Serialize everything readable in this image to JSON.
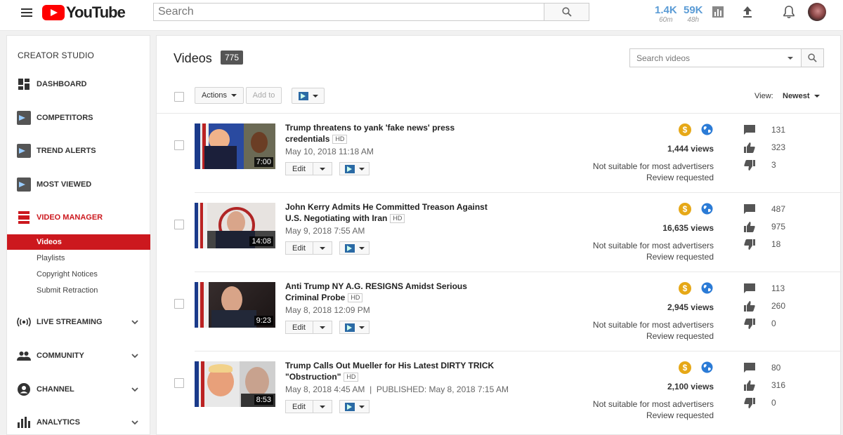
{
  "topbar": {
    "logo_text": "YouTube",
    "search_placeholder": "Search",
    "stats": [
      {
        "value": "1.4K",
        "period": "60m"
      },
      {
        "value": "59K",
        "period": "48h"
      }
    ]
  },
  "sidebar": {
    "title": "CREATOR STUDIO",
    "items": [
      {
        "label": "DASHBOARD",
        "icon": "dashboard-icon"
      },
      {
        "label": "COMPETITORS",
        "icon": "vidiq-icon"
      },
      {
        "label": "TREND ALERTS",
        "icon": "vidiq-icon"
      },
      {
        "label": "MOST VIEWED",
        "icon": "vidiq-icon"
      },
      {
        "label": "VIDEO MANAGER",
        "icon": "video-manager-icon"
      },
      {
        "label": "LIVE STREAMING",
        "icon": "live-icon"
      },
      {
        "label": "COMMUNITY",
        "icon": "community-icon"
      },
      {
        "label": "CHANNEL",
        "icon": "channel-icon"
      },
      {
        "label": "ANALYTICS",
        "icon": "analytics-icon"
      }
    ],
    "subitems": [
      "Videos",
      "Playlists",
      "Copyright Notices",
      "Submit Retraction"
    ]
  },
  "main": {
    "title": "Videos",
    "count": "775",
    "search_placeholder": "Search videos",
    "actions_label": "Actions",
    "add_to_label": "Add to",
    "view_label": "View:",
    "view_value": "Newest",
    "edit_label": "Edit",
    "videos": [
      {
        "title": "Trump threatens to yank 'fake news' press credentials",
        "hd": "HD",
        "date": "May 10, 2018 11:18 AM",
        "duration": "7:00",
        "views": "1,444 views",
        "ad_status": "Not suitable for most advertisers",
        "review": "Review requested",
        "comments": "131",
        "likes": "323",
        "dislikes": "3"
      },
      {
        "title": "John Kerry Admits He Committed Treason Against U.S. Negotiating with Iran",
        "hd": "HD",
        "date": "May 9, 2018 7:55 AM",
        "duration": "14:08",
        "views": "16,635 views",
        "ad_status": "Not suitable for most advertisers",
        "review": "Review requested",
        "comments": "487",
        "likes": "975",
        "dislikes": "18"
      },
      {
        "title": "Anti Trump NY A.G. RESIGNS Amidst Serious Criminal Probe",
        "hd": "HD",
        "date": "May 8, 2018 12:09 PM",
        "duration": "9:23",
        "views": "2,945 views",
        "ad_status": "Not suitable for most advertisers",
        "review": "Review requested",
        "comments": "113",
        "likes": "260",
        "dislikes": "0"
      },
      {
        "title": "Trump Calls Out Mueller for His Latest DIRTY TRICK \"Obstruction\"",
        "hd": "HD",
        "date": "May 8, 2018 4:45 AM  |  PUBLISHED: May 8, 2018 7:15 AM",
        "duration": "8:53",
        "views": "2,100 views",
        "ad_status": "Not suitable for most advertisers",
        "review": "Review requested",
        "comments": "80",
        "likes": "316",
        "dislikes": "0"
      }
    ]
  },
  "colors": {
    "brand_red": "#ff0000",
    "studio_red": "#cc181e",
    "stat_blue": "#5a9bd5",
    "monetization_gold": "#e6a817",
    "globe_blue": "#2b7bd6"
  }
}
